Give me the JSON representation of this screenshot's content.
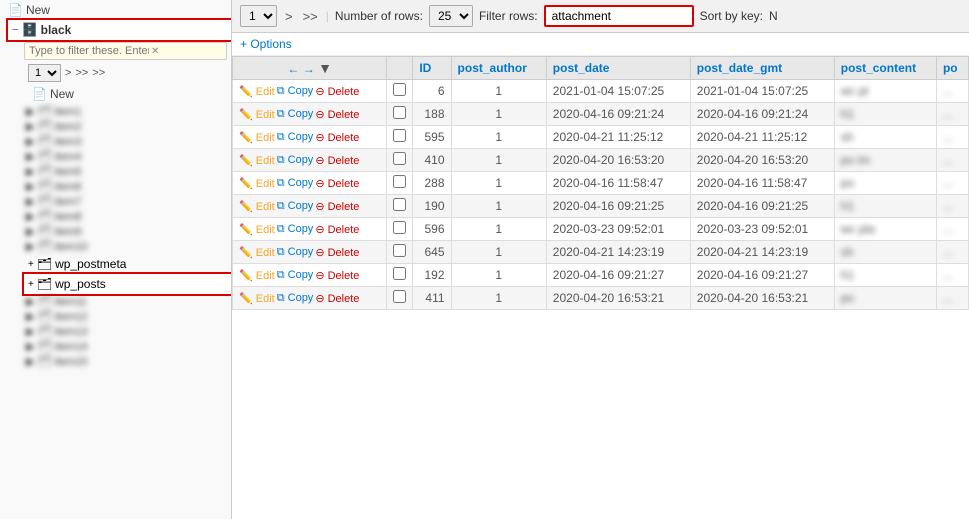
{
  "sidebar": {
    "new_label": "New",
    "black_label": "black",
    "filter_placeholder": "Type to filter these. Enter to s",
    "filter_value": "",
    "page_select": "1",
    "nav_arrows": ">>>",
    "new2_label": "New",
    "wp_postmeta_label": "wp_postmeta",
    "wp_posts_label": "wp_posts"
  },
  "toolbar": {
    "page_select_value": "1",
    "nav_next": ">",
    "nav_next_end": ">>",
    "rows_label": "Number of rows:",
    "rows_select": "25",
    "filter_label": "Filter rows:",
    "filter_value": "attachment",
    "sort_label": "Sort by key:",
    "sort_value": "N"
  },
  "options": {
    "label": "+ Options"
  },
  "table": {
    "cols": [
      "",
      "",
      "ID",
      "post_author",
      "post_date",
      "post_date_gmt",
      "post_content",
      "po"
    ],
    "rows": [
      {
        "id": "6",
        "post_author": "1",
        "post_date": "2021-01-04 15:07:25",
        "post_date_gmt": "2021-01-04 15:07:25",
        "post_content": "wc pl"
      },
      {
        "id": "188",
        "post_author": "1",
        "post_date": "2020-04-16 09:21:24",
        "post_date_gmt": "2020-04-16 09:21:24",
        "post_content": "h1"
      },
      {
        "id": "595",
        "post_author": "1",
        "post_date": "2020-04-21 11:25:12",
        "post_date_gmt": "2020-04-21 11:25:12",
        "post_content": "sh"
      },
      {
        "id": "410",
        "post_author": "1",
        "post_date": "2020-04-20 16:53:20",
        "post_date_gmt": "2020-04-20 16:53:20",
        "post_content": "po im"
      },
      {
        "id": "288",
        "post_author": "1",
        "post_date": "2020-04-16 11:58:47",
        "post_date_gmt": "2020-04-16 11:58:47",
        "post_content": "po"
      },
      {
        "id": "190",
        "post_author": "1",
        "post_date": "2020-04-16 09:21:25",
        "post_date_gmt": "2020-04-16 09:21:25",
        "post_content": "h1"
      },
      {
        "id": "596",
        "post_author": "1",
        "post_date": "2020-03-23 09:52:01",
        "post_date_gmt": "2020-03-23 09:52:01",
        "post_content": "wc pla"
      },
      {
        "id": "645",
        "post_author": "1",
        "post_date": "2020-04-21 14:23:19",
        "post_date_gmt": "2020-04-21 14:23:19",
        "post_content": "sh"
      },
      {
        "id": "192",
        "post_author": "1",
        "post_date": "2020-04-16 09:21:27",
        "post_date_gmt": "2020-04-16 09:21:27",
        "post_content": "h1"
      },
      {
        "id": "411",
        "post_author": "1",
        "post_date": "2020-04-20 16:53:21",
        "post_date_gmt": "2020-04-20 16:53:21",
        "post_content": "po"
      }
    ],
    "action_edit": "Edit",
    "action_copy": "Copy",
    "action_delete": "Delete"
  }
}
